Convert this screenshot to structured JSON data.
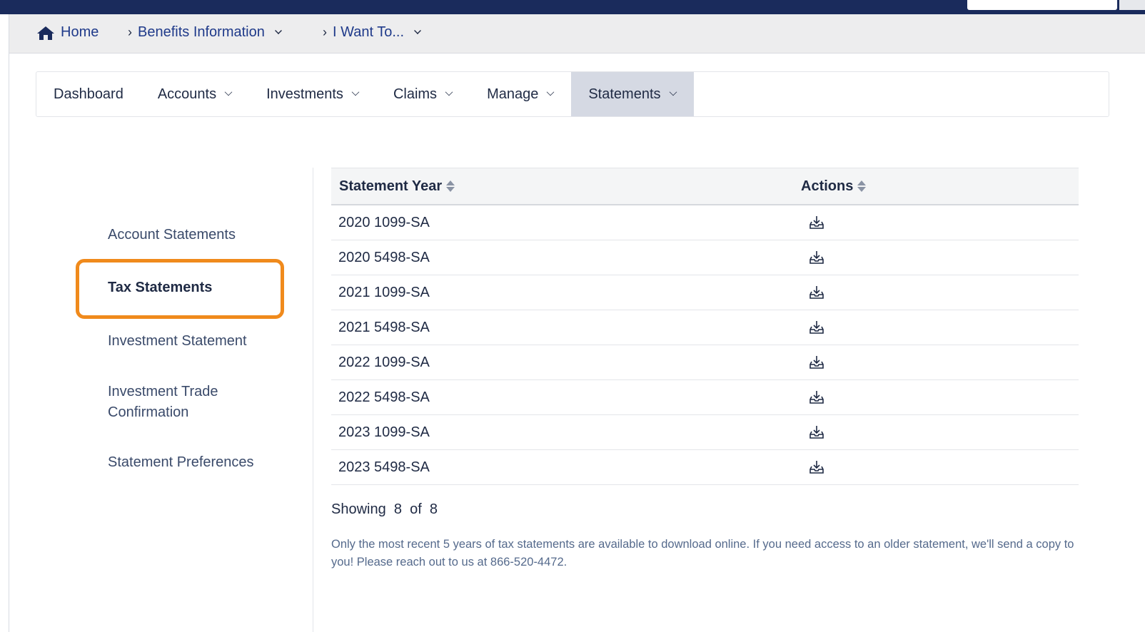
{
  "breadcrumb": {
    "home": "Home",
    "benefits": "Benefits Information",
    "iwant": "I Want To..."
  },
  "nav": {
    "dashboard": "Dashboard",
    "accounts": "Accounts",
    "investments": "Investments",
    "claims": "Claims",
    "manage": "Manage",
    "statements": "Statements"
  },
  "sidebar": {
    "items": [
      {
        "label": "Account Statements"
      },
      {
        "label": "Tax Statements"
      },
      {
        "label": "Investment Statement"
      },
      {
        "label": "Investment Trade Confirmation"
      },
      {
        "label": "Statement Preferences"
      }
    ]
  },
  "table": {
    "col_year": "Statement Year",
    "col_actions": "Actions",
    "rows": [
      {
        "year": "2020 1099-SA"
      },
      {
        "year": "2020 5498-SA"
      },
      {
        "year": "2021 1099-SA"
      },
      {
        "year": "2021 5498-SA"
      },
      {
        "year": "2022 1099-SA"
      },
      {
        "year": "2022 5498-SA"
      },
      {
        "year": "2023 1099-SA"
      },
      {
        "year": "2023 5498-SA"
      }
    ]
  },
  "pagination": {
    "showing_text": "Showing  8  of  8"
  },
  "note": "Only the most recent 5 years of tax statements are available to download online. If you need access to an older statement, we'll send a copy to you! Please reach out to us at 866-520-4472.",
  "colors": {
    "brand": "#1a2b5c",
    "highlight": "#f08a1c",
    "active_tab": "#d5d9e3"
  },
  "icons": [
    "home-icon",
    "chevron-right-icon",
    "chevron-down-icon",
    "sort-icon",
    "download-icon"
  ]
}
